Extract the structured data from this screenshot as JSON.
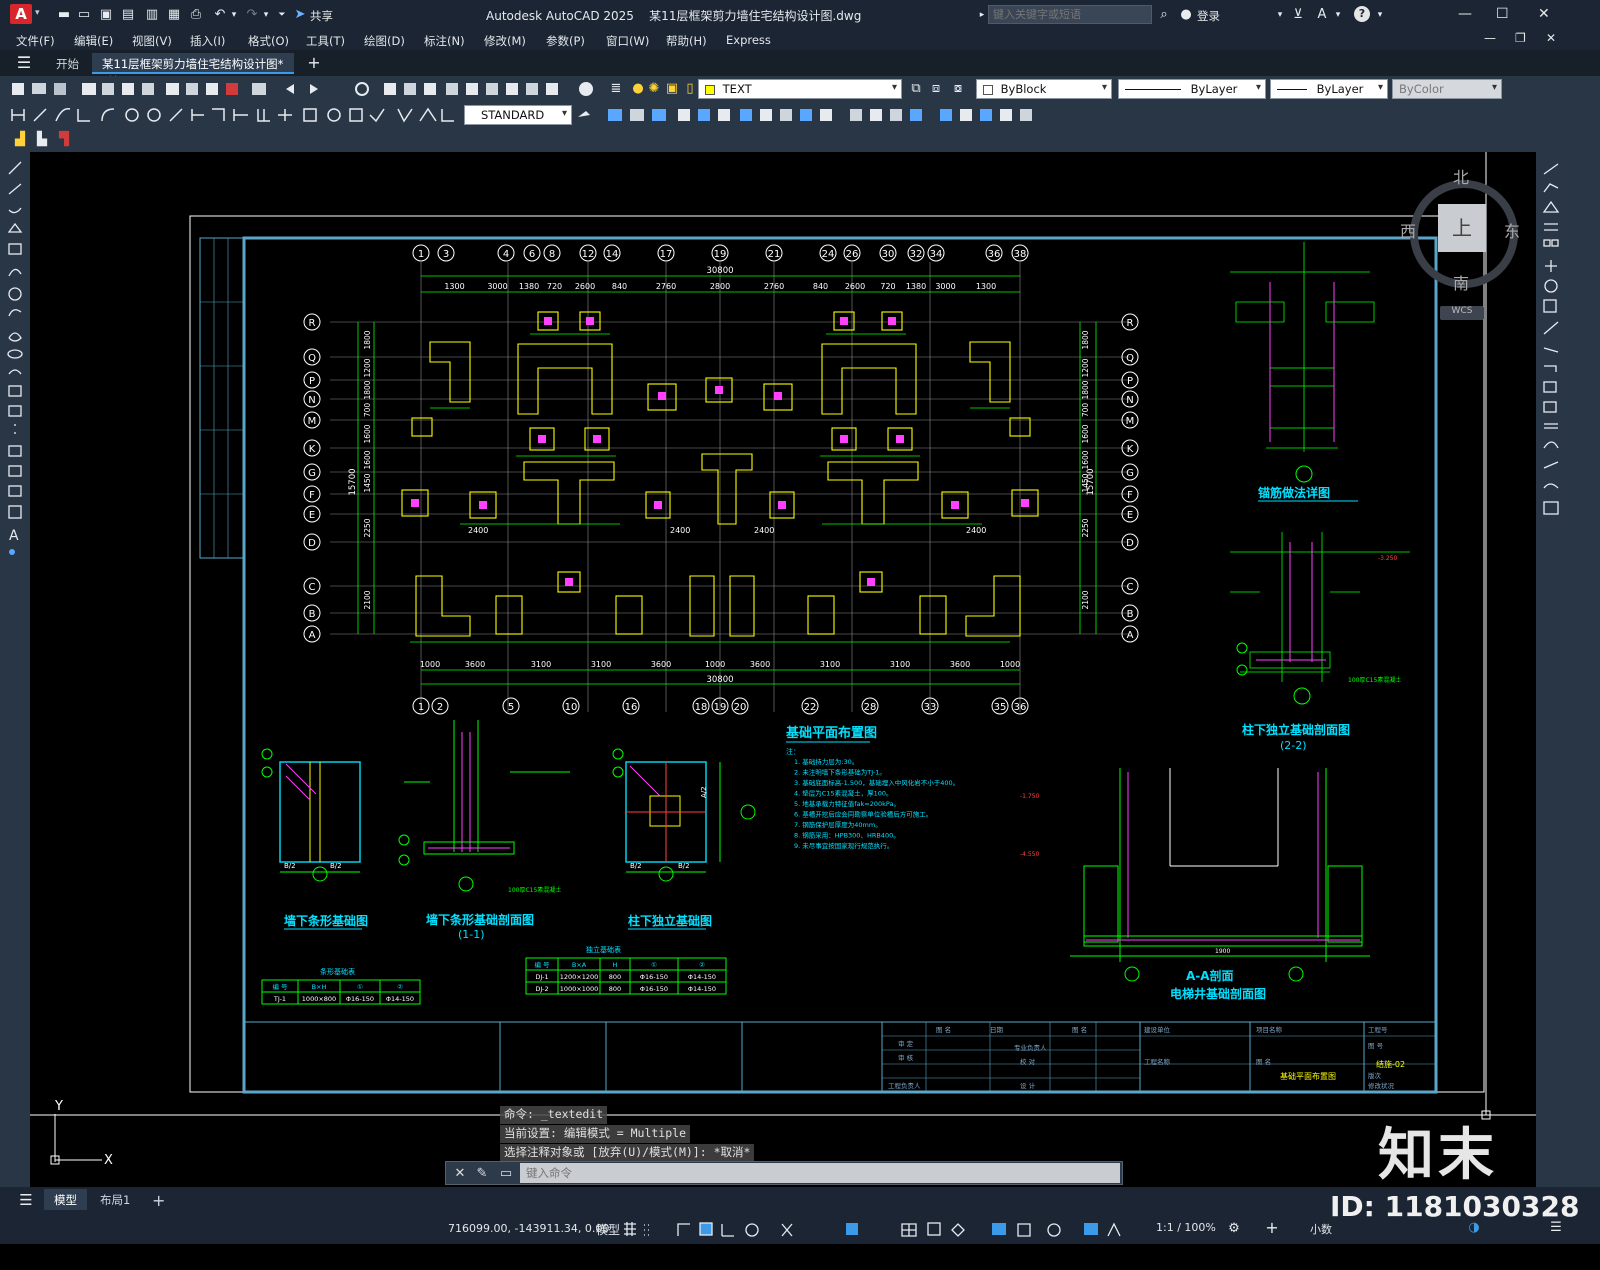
{
  "titlebar": {
    "app_badge": "A",
    "share_label": "共享",
    "title": "Autodesk AutoCAD 2025    某11层框架剪力墙住宅结构设计图.dwg",
    "search_placeholder": "键入关键字或短语",
    "login_label": "登录"
  },
  "menubar": {
    "items": [
      "文件(F)",
      "编辑(E)",
      "视图(V)",
      "插入(I)",
      "格式(O)",
      "工具(T)",
      "绘图(D)",
      "标注(N)",
      "修改(M)",
      "参数(P)",
      "窗口(W)",
      "帮助(H)",
      "Express"
    ]
  },
  "tabs": {
    "start": "开始",
    "document": "某11层框架剪力墙住宅结构设计图*"
  },
  "properties": {
    "layer": "TEXT",
    "color": "ByBlock",
    "linetype": "ByLayer",
    "lineweight": "ByLayer",
    "plotstyle": "ByColor",
    "textstyle": "STANDARD"
  },
  "viewcube": {
    "north": "北",
    "south": "南",
    "east": "东",
    "west": "西",
    "top": "上",
    "wcs": "WCS"
  },
  "drawing": {
    "axis_top": [
      "1",
      "3",
      "4",
      "6",
      "8",
      "12",
      "14",
      "17",
      "19",
      "21",
      "24",
      "26",
      "30",
      "32",
      "34",
      "36",
      "38"
    ],
    "axis_bottom": [
      "1",
      "2",
      "5",
      "10",
      "16",
      "18",
      "19",
      "20",
      "22",
      "28",
      "33",
      "35",
      "36"
    ],
    "axis_rows": [
      "R",
      "Q",
      "P",
      "N",
      "M",
      "K",
      "G",
      "F",
      "E",
      "D",
      "C",
      "B",
      "A"
    ],
    "dim_top_total": "30800",
    "dim_top": [
      "1300",
      "3000",
      "1380",
      "720",
      "2600",
      "840",
      "2760",
      "2800",
      "2760",
      "840",
      "2600",
      "720",
      "1380",
      "3000",
      "1300"
    ],
    "dim_bottom_total": "30800",
    "dim_bottom": [
      "1000",
      "3600",
      "3100",
      "3100",
      "3600",
      "1000",
      "3600",
      "3100",
      "3100",
      "3600",
      "1000"
    ],
    "dim_left_total": "15700",
    "dim_left": [
      "1800",
      "1200",
      "1800",
      "700",
      "1600",
      "1600",
      "1450",
      "2250",
      "2100"
    ],
    "titles": {
      "plan": "基础平面布置图",
      "anchor": "锚筋做法详图",
      "col_section": "柱下独立基础剖面图",
      "col_section_sub": "(2-2)",
      "strip": "墙下条形基础图",
      "strip_section": "墙下条形基础剖面图",
      "strip_section_sub": "(1-1)",
      "col_found": "柱下独立基础图",
      "elevator": "A-A剖面",
      "elevator_sub": "电梯井基础剖面图"
    },
    "notes_title": "注：",
    "notes": [
      "1. 基础持力层为:30。",
      "2. 未注明墙下条形基础为TJ-1。",
      "3. 基础底面标高-1.500，基础埋入中风化岩不小于400。",
      "4. 垫层为C15素混凝土，厚100。",
      "5. 地基承载力特征值fak=200kPa。",
      "6. 基槽开挖后应会同勘察单位验槽后方可施工。",
      "7. 钢筋保护层厚度为40mm。",
      "8. 钢筋采用：HPB300、HRB400。",
      "9. 未尽事宜按国家现行规范执行。"
    ],
    "strip_table": {
      "title": "条形基础表",
      "headers": [
        "编 号",
        "B×H",
        "①",
        "②"
      ],
      "rows": [
        [
          "TJ-1",
          "1000×800",
          "Φ16-150",
          "Φ14-150"
        ]
      ]
    },
    "col_table": {
      "title": "独立基础表",
      "headers": [
        "编 号",
        "B×A",
        "H",
        "①",
        "②"
      ],
      "rows": [
        [
          "DJ-1",
          "1200×1200",
          "800",
          "Φ16-150",
          "Φ14-150"
        ],
        [
          "DJ-2",
          "1000×1000",
          "800",
          "Φ16-150",
          "Φ14-150"
        ]
      ]
    },
    "titleblock": {
      "drawing_name": "基础平面布置图",
      "drawing_no": "结施-02",
      "cells": [
        "图 名",
        "日期",
        "图 名",
        "建设单位",
        "项目名称",
        "工程号",
        "审 定",
        "专业负责人",
        "图 号",
        "审 核",
        "校 对",
        "工程名称",
        "图 名",
        "版次",
        "工程负责人",
        "设 计",
        "修改状况"
      ]
    },
    "cad_texts": {
      "tag_a": "A/2",
      "tag_b": "B/2",
      "cushion": "100厚C15素混凝土",
      "elev_1": "-3.250",
      "elev_2": "-1.750",
      "elev_3": "-4.550",
      "elev_dim": "1900"
    }
  },
  "ucs": {
    "y": "Y",
    "x": "X"
  },
  "command": {
    "lines": [
      "命令: _textedit",
      "当前设置: 编辑模式 = Multiple",
      "选择注释对象或 [放弃(U)/模式(M)]: *取消*"
    ],
    "placeholder": "键入命令"
  },
  "layout_tabs": {
    "model": "模型",
    "layout1": "布局1",
    "add": "+"
  },
  "status": {
    "coords": "716099.00, -143911.34, 0.00",
    "model": "模型",
    "scale": "1:1 / 100%",
    "units": "小数"
  },
  "watermark": {
    "brand": "知末",
    "id": "ID: 1181030328"
  }
}
